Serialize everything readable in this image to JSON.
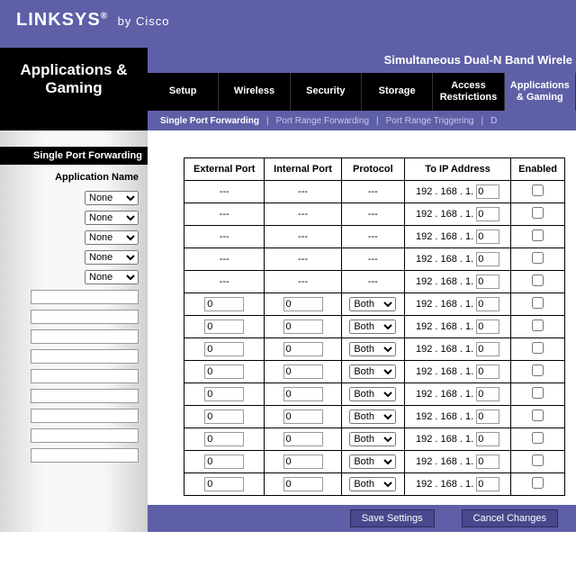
{
  "brand": {
    "logo": "LINKSYS",
    "reg": "®",
    "by": "by Cisco"
  },
  "product_name": "Simultaneous Dual-N Band Wirele",
  "page_title": "Applications & Gaming",
  "nav": [
    "Setup",
    "Wireless",
    "Security",
    "Storage",
    "Access Restrictions",
    "Applications & Gaming"
  ],
  "nav_active": 5,
  "subnav": [
    "Single Port Forwarding",
    "Port Range Forwarding",
    "Port Range Triggering",
    "D"
  ],
  "subnav_active": 0,
  "sidebar_heading": "Single Port Forwarding",
  "app_name_label": "Application Name",
  "preset_value": "None",
  "columns": [
    "External Port",
    "Internal Port",
    "Protocol",
    "To IP Address",
    "Enabled"
  ],
  "ip_prefix": "192 . 168 . 1.",
  "preset_rows": [
    {
      "ext": "---",
      "int": "---",
      "proto": "---",
      "ip": "0"
    },
    {
      "ext": "---",
      "int": "---",
      "proto": "---",
      "ip": "0"
    },
    {
      "ext": "---",
      "int": "---",
      "proto": "---",
      "ip": "0"
    },
    {
      "ext": "---",
      "int": "---",
      "proto": "---",
      "ip": "0"
    },
    {
      "ext": "---",
      "int": "---",
      "proto": "---",
      "ip": "0"
    }
  ],
  "custom_rows": [
    {
      "ext": "0",
      "int": "0",
      "proto": "Both",
      "ip": "0"
    },
    {
      "ext": "0",
      "int": "0",
      "proto": "Both",
      "ip": "0"
    },
    {
      "ext": "0",
      "int": "0",
      "proto": "Both",
      "ip": "0"
    },
    {
      "ext": "0",
      "int": "0",
      "proto": "Both",
      "ip": "0"
    },
    {
      "ext": "0",
      "int": "0",
      "proto": "Both",
      "ip": "0"
    },
    {
      "ext": "0",
      "int": "0",
      "proto": "Both",
      "ip": "0"
    },
    {
      "ext": "0",
      "int": "0",
      "proto": "Both",
      "ip": "0"
    },
    {
      "ext": "0",
      "int": "0",
      "proto": "Both",
      "ip": "0"
    },
    {
      "ext": "0",
      "int": "0",
      "proto": "Both",
      "ip": "0"
    }
  ],
  "buttons": {
    "save": "Save Settings",
    "cancel": "Cancel Changes"
  }
}
